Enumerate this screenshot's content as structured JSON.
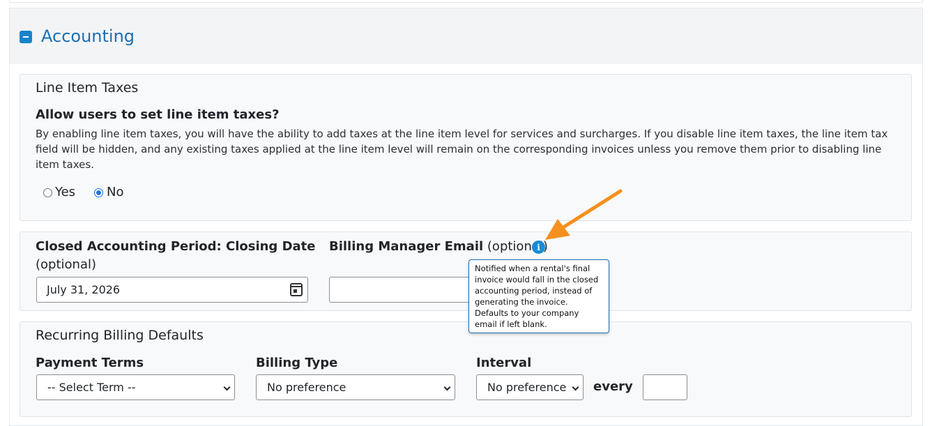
{
  "panel": {
    "title": "Accounting"
  },
  "line_item_taxes": {
    "heading": "Line Item Taxes",
    "question": "Allow users to set line item taxes?",
    "description": "By enabling line item taxes, you will have the ability to add taxes at the line item level for services and surcharges. If you disable line item taxes, the line item tax field will be hidden, and any existing taxes applied at the line item level will remain on the corresponding invoices unless you remove them prior to disabling line item taxes.",
    "options": [
      {
        "label": "Yes",
        "checked": false
      },
      {
        "label": "No",
        "checked": true
      }
    ]
  },
  "closing": {
    "label": "Closed Accounting Period: Closing Date",
    "optional": "(optional)",
    "value": "July 31, 2026"
  },
  "billing_manager": {
    "label": "Billing Manager Email",
    "optional": "(optional)",
    "value": "",
    "info_glyph": "i",
    "tooltip": "Notified when a rental's final invoice would fall in the closed accounting period, instead of generating the invoice. Defaults to your company email if left blank."
  },
  "recurring": {
    "heading": "Recurring Billing Defaults",
    "payment_terms": {
      "label": "Payment Terms",
      "selected": "-- Select Term --"
    },
    "billing_type": {
      "label": "Billing Type",
      "selected": "No preference"
    },
    "interval": {
      "label": "Interval",
      "selected": "No preference",
      "every_label": "every",
      "every_value": ""
    }
  },
  "colors": {
    "accent": "#1a6fb3",
    "annotation_arrow": "#f5901e"
  }
}
